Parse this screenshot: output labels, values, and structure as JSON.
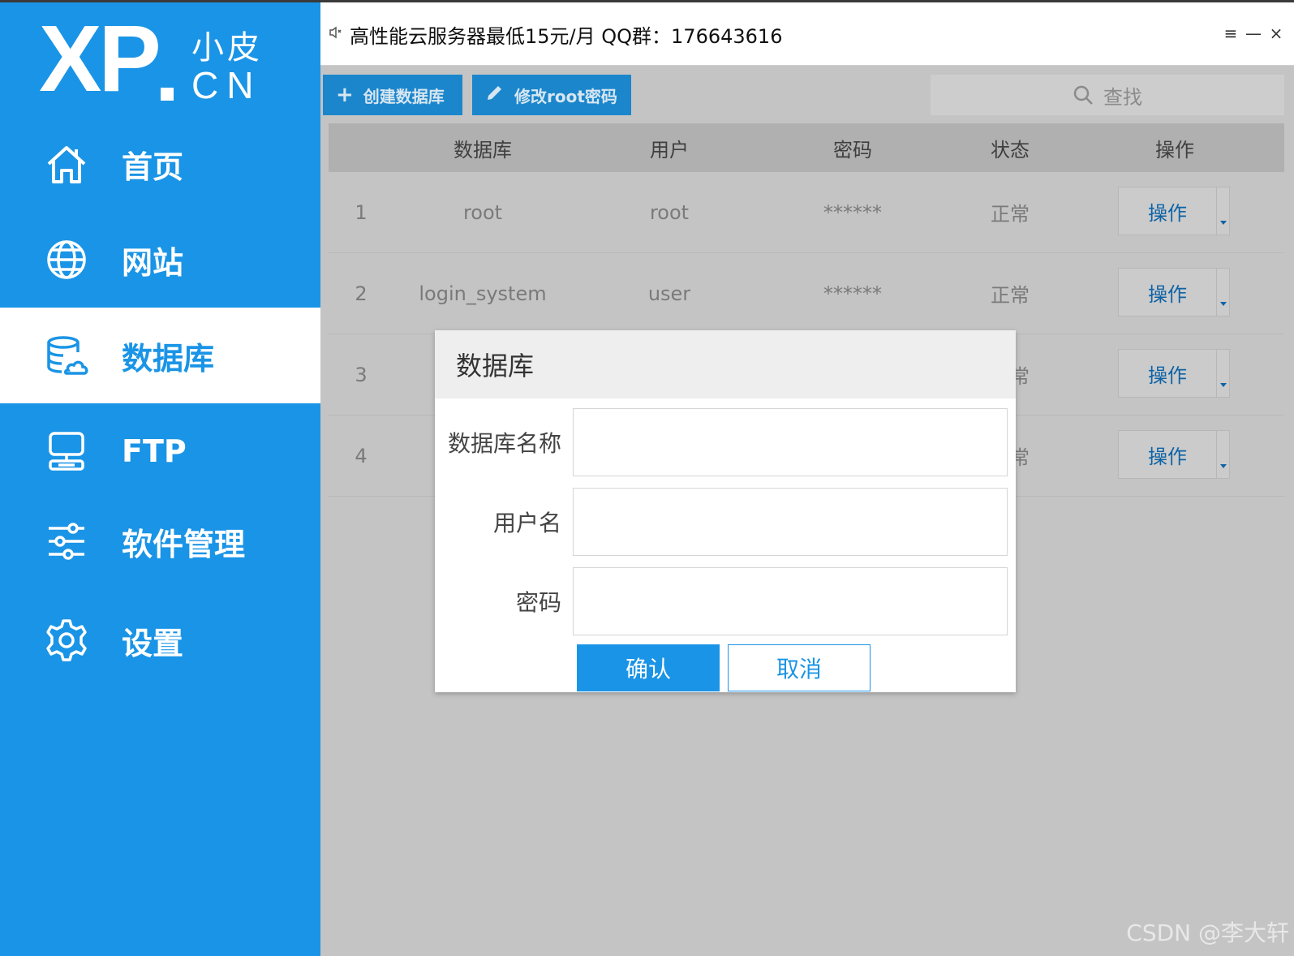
{
  "colors": {
    "accent": "#1a94e6",
    "toolbar_button": "#1b86cc",
    "overlay_gray": "#c4c4c4",
    "link_blue": "#0e63a6"
  },
  "logo": {
    "xp": "XP",
    "cn_top": "小皮",
    "cn_bottom": "CN"
  },
  "sidebar": {
    "items": [
      {
        "label": "首页",
        "icon": "home-icon",
        "active": false
      },
      {
        "label": "网站",
        "icon": "globe-icon",
        "active": false
      },
      {
        "label": "数据库",
        "icon": "database-icon",
        "active": true
      },
      {
        "label": "FTP",
        "icon": "ftp-server-icon",
        "active": false
      },
      {
        "label": "软件管理",
        "icon": "sliders-icon",
        "active": false
      },
      {
        "label": "设置",
        "icon": "gear-icon",
        "active": false
      }
    ]
  },
  "titlebar": {
    "marquee": "高性能云服务器最低15元/月  QQ群：176643616",
    "menu_glyph": "≡",
    "minimize_glyph": "—",
    "close_glyph": "×"
  },
  "toolbar": {
    "create_db_label": "创建数据库",
    "change_root_pw_label": "修改root密码",
    "search_label": "查找"
  },
  "table": {
    "headers": [
      "数据库",
      "用户",
      "密码",
      "状态",
      "操作"
    ],
    "rows": [
      {
        "index": "1",
        "database": "root",
        "user": "root",
        "password": "******",
        "status": "正常",
        "action": "操作"
      },
      {
        "index": "2",
        "database": "login_system",
        "user": "user",
        "password": "******",
        "status": "正常",
        "action": "操作"
      },
      {
        "index": "3",
        "database": "",
        "user": "",
        "password": "",
        "status": "常",
        "action": "操作"
      },
      {
        "index": "4",
        "database": "",
        "user": "",
        "password": "",
        "status": "常",
        "action": "操作"
      }
    ]
  },
  "modal": {
    "title": "数据库",
    "fields": {
      "db_name_label": "数据库名称",
      "db_name_value": "",
      "username_label": "用户名",
      "username_value": "",
      "password_label": "密码",
      "password_value": ""
    },
    "confirm_label": "确认",
    "cancel_label": "取消"
  },
  "watermark": "CSDN @李大轩"
}
